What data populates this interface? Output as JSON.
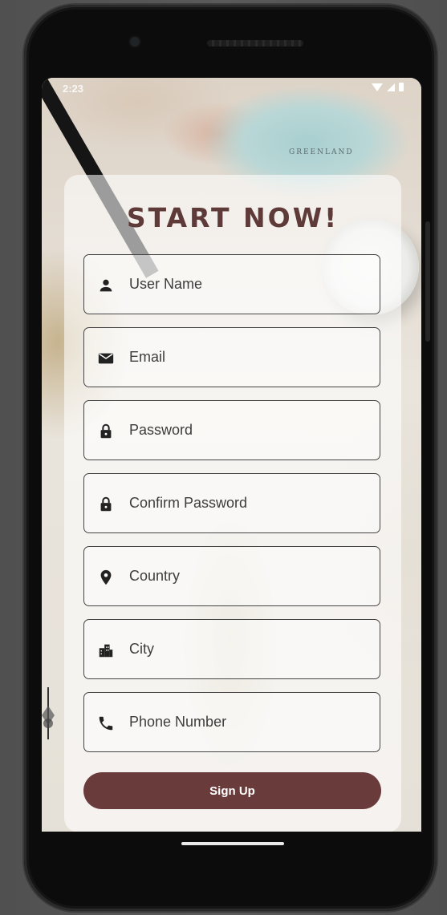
{
  "status_bar": {
    "time": "2:23"
  },
  "background": {
    "map_label": "GREENLAND"
  },
  "form": {
    "title": "START NOW!",
    "fields": [
      {
        "placeholder": "User Name",
        "icon": "person-icon"
      },
      {
        "placeholder": "Email",
        "icon": "envelope-icon"
      },
      {
        "placeholder": "Password",
        "icon": "lock-icon"
      },
      {
        "placeholder": "Confirm Password",
        "icon": "lock-icon"
      },
      {
        "placeholder": "Country",
        "icon": "location-pin-icon"
      },
      {
        "placeholder": "City",
        "icon": "city-icon"
      },
      {
        "placeholder": "Phone Number",
        "icon": "phone-icon"
      }
    ],
    "submit_label": "Sign Up"
  },
  "colors": {
    "accent": "#6a3b3b",
    "title": "#5e3a39"
  }
}
